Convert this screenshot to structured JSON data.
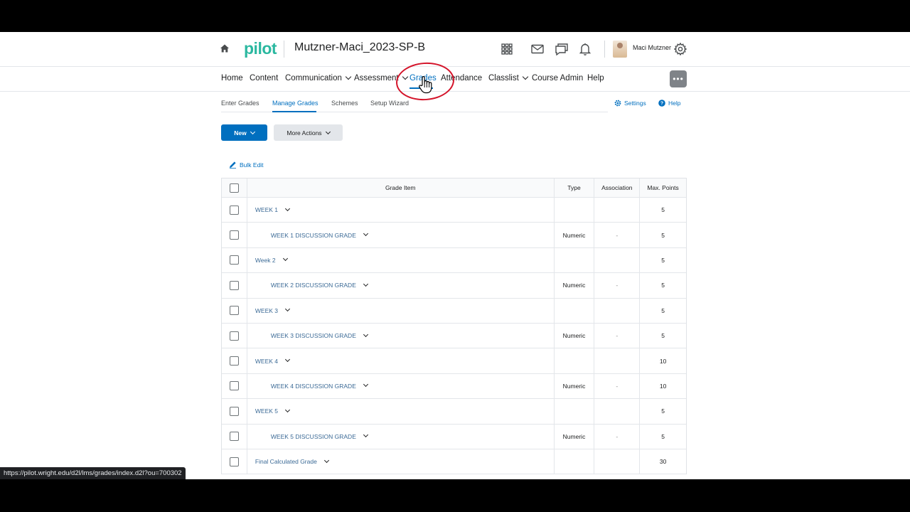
{
  "header": {
    "logo": "pilot",
    "course_title": "Mutzner-Maci_2023-SP-B",
    "user_name": "Maci Mutzner"
  },
  "nav": {
    "items": [
      {
        "label": "Home",
        "dropdown": false
      },
      {
        "label": "Content",
        "dropdown": false
      },
      {
        "label": "Communication",
        "dropdown": true
      },
      {
        "label": "Assessment",
        "dropdown": true
      },
      {
        "label": "Grades",
        "dropdown": false
      },
      {
        "label": "Attendance",
        "dropdown": false
      },
      {
        "label": "Classlist",
        "dropdown": true
      },
      {
        "label": "Course Admin",
        "dropdown": false
      },
      {
        "label": "Help",
        "dropdown": false
      }
    ],
    "active": "Grades",
    "more_label": "•••"
  },
  "subtabs": {
    "items": [
      "Enter Grades",
      "Manage Grades",
      "Schemes",
      "Setup Wizard"
    ],
    "active": "Manage Grades",
    "settings_label": "Settings",
    "help_label": "Help"
  },
  "actions": {
    "new_label": "New",
    "more_actions_label": "More Actions",
    "bulk_edit_label": "Bulk Edit"
  },
  "table": {
    "columns": [
      "Grade Item",
      "Type",
      "Association",
      "Max. Points"
    ],
    "rows": [
      {
        "name": "WEEK 1",
        "level": 0,
        "type": "",
        "association": "",
        "max_points": "5"
      },
      {
        "name": "WEEK 1 DISCUSSION GRADE",
        "level": 1,
        "type": "Numeric",
        "association": "-",
        "max_points": "5"
      },
      {
        "name": "Week 2",
        "level": 0,
        "type": "",
        "association": "",
        "max_points": "5"
      },
      {
        "name": "WEEK 2 DISCUSSION GRADE",
        "level": 1,
        "type": "Numeric",
        "association": "-",
        "max_points": "5"
      },
      {
        "name": "WEEK 3",
        "level": 0,
        "type": "",
        "association": "",
        "max_points": "5"
      },
      {
        "name": "WEEK 3 DISCUSSION GRADE",
        "level": 1,
        "type": "Numeric",
        "association": "-",
        "max_points": "5"
      },
      {
        "name": "WEEK 4",
        "level": 0,
        "type": "",
        "association": "",
        "max_points": "10"
      },
      {
        "name": "WEEK 4 DISCUSSION GRADE",
        "level": 1,
        "type": "Numeric",
        "association": "-",
        "max_points": "10"
      },
      {
        "name": "WEEK 5",
        "level": 0,
        "type": "",
        "association": "",
        "max_points": "5"
      },
      {
        "name": "WEEK 5 DISCUSSION GRADE",
        "level": 1,
        "type": "Numeric",
        "association": "-",
        "max_points": "5"
      },
      {
        "name": "Final Calculated Grade",
        "level": 0,
        "type": "",
        "association": "",
        "max_points": "30"
      }
    ]
  },
  "status_bar": {
    "url": "https://pilot.wright.edu/d2l/lms/grades/index.d2l?ou=700302"
  },
  "colors": {
    "accent": "#006fbf",
    "logo": "#2bb8a0",
    "annotation": "#d4142a"
  }
}
